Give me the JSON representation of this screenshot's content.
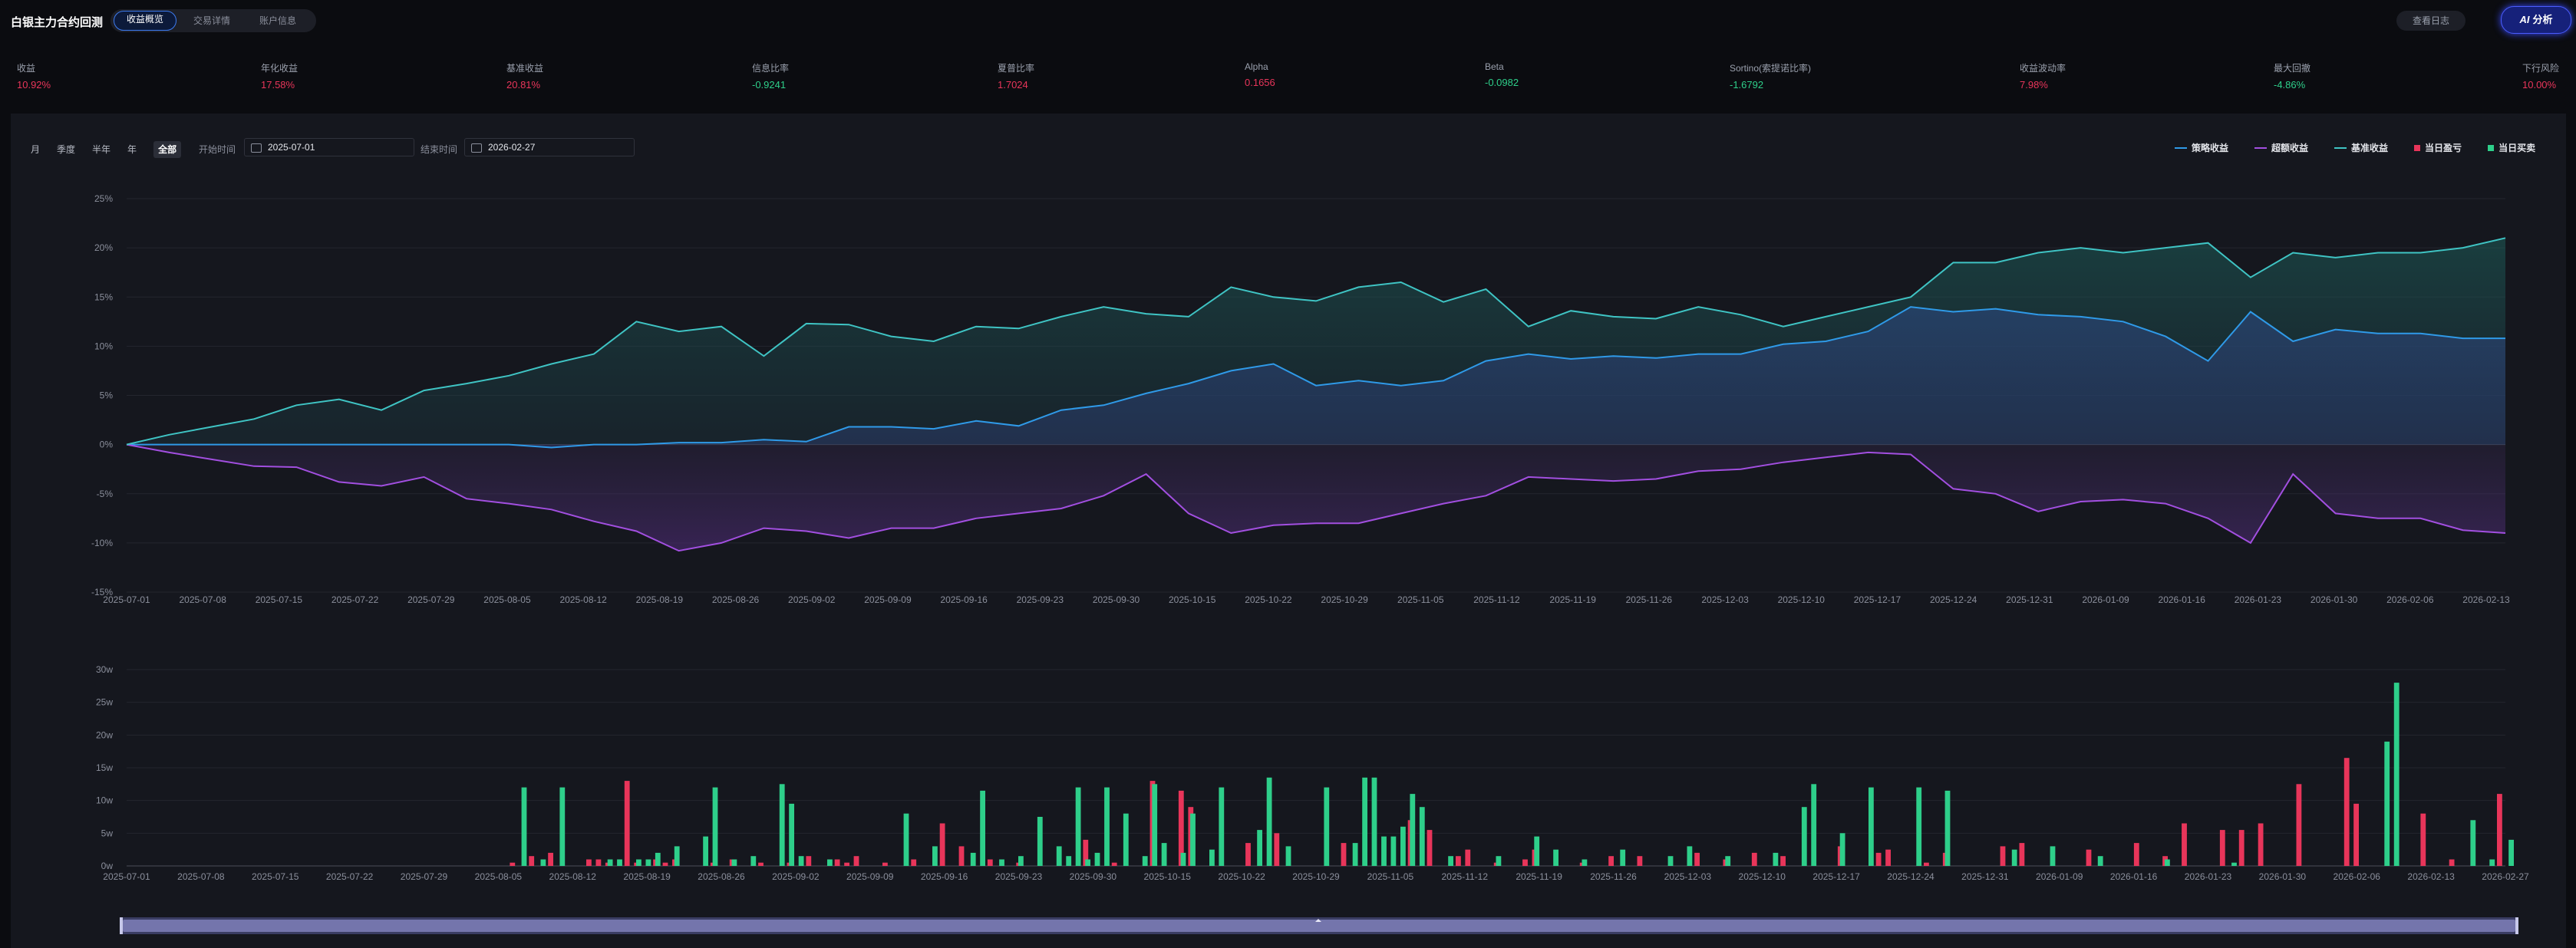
{
  "app": {
    "title": "白银主力合约回测"
  },
  "tabs": [
    {
      "label": "收益概览",
      "active": true
    },
    {
      "label": "交易详情",
      "active": false
    },
    {
      "label": "账户信息",
      "active": false
    }
  ],
  "header": {
    "log_button": "查看日志",
    "ai_button": "分析",
    "ai_icon": "AI"
  },
  "metrics": [
    {
      "label": "收益",
      "value": "10.92%",
      "color": "#e8355a"
    },
    {
      "label": "年化收益",
      "value": "17.58%",
      "color": "#e8355a"
    },
    {
      "label": "基准收益",
      "value": "20.81%",
      "color": "#e8355a"
    },
    {
      "label": "信息比率",
      "value": "-0.9241",
      "color": "#2ecf8a"
    },
    {
      "label": "夏普比率",
      "value": "1.7024",
      "color": "#e8355a"
    },
    {
      "label": "Alpha",
      "value": "0.1656",
      "color": "#e8355a"
    },
    {
      "label": "Beta",
      "value": "-0.0982",
      "color": "#2ecf8a"
    },
    {
      "label": "Sortino(索提诺比率)",
      "value": "-1.6792",
      "color": "#2ecf8a"
    },
    {
      "label": "收益波动率",
      "value": "7.98%",
      "color": "#e8355a"
    },
    {
      "label": "最大回撤",
      "value": "-4.86%",
      "color": "#2ecf8a"
    },
    {
      "label": "下行风险",
      "value": "10.00%",
      "color": "#e8355a"
    }
  ],
  "periods": [
    {
      "label": "月",
      "active": false
    },
    {
      "label": "季度",
      "active": false
    },
    {
      "label": "半年",
      "active": false
    },
    {
      "label": "年",
      "active": false
    },
    {
      "label": "全部",
      "active": true
    }
  ],
  "date_range": {
    "start_label": "开始时间",
    "start_value": "2025-07-01",
    "end_label": "结束时间",
    "end_value": "2026-02-27"
  },
  "legend": [
    {
      "label": "策略收益",
      "kind": "line",
      "color": "#2f9ae8"
    },
    {
      "label": "超额收益",
      "kind": "line",
      "color": "#a24fe0"
    },
    {
      "label": "基准收益",
      "kind": "line",
      "color": "#3fc4c4"
    },
    {
      "label": "当日盈亏",
      "kind": "bar",
      "color": "#e8355a"
    },
    {
      "label": "当日买卖",
      "kind": "bar",
      "color": "#2ecf8a"
    }
  ],
  "chart_data": [
    {
      "type": "line",
      "ylim": [
        -15,
        25
      ],
      "y_ticks": [
        "-15%",
        "-10%",
        "-5%",
        "0%",
        "5%",
        "10%",
        "15%",
        "20%",
        "25%"
      ],
      "x_ticks": [
        "2025-07-01",
        "2025-07-08",
        "2025-07-15",
        "2025-07-22",
        "2025-07-29",
        "2025-08-05",
        "2025-08-12",
        "2025-08-19",
        "2025-08-26",
        "2025-09-02",
        "2025-09-09",
        "2025-09-16",
        "2025-09-23",
        "2025-09-30",
        "2025-10-15",
        "2025-10-22",
        "2025-10-29",
        "2025-11-05",
        "2025-11-12",
        "2025-11-19",
        "2025-11-26",
        "2025-12-03",
        "2025-12-10",
        "2025-12-17",
        "2025-12-24",
        "2025-12-31",
        "2026-01-09",
        "2026-01-16",
        "2026-01-23",
        "2026-01-30",
        "2026-02-06",
        "2026-02-13"
      ],
      "series": [
        {
          "name": "策略收益",
          "color": "#2f9ae8",
          "values": [
            0,
            0,
            0,
            0,
            0,
            0,
            0,
            0,
            0,
            0,
            -0.3,
            0,
            0,
            0.2,
            0.2,
            0.5,
            0.3,
            1.8,
            1.8,
            1.6,
            2.4,
            1.9,
            3.5,
            4.0,
            5.2,
            6.2,
            7.5,
            8.2,
            6.0,
            6.5,
            6.0,
            6.5,
            8.5,
            9.2,
            8.7,
            9.0,
            8.8,
            9.2,
            9.2,
            10.2,
            10.5,
            11.5,
            14.0,
            13.5,
            13.8,
            13.2,
            13.0,
            12.5,
            11.0,
            8.5,
            13.5,
            10.5,
            11.7,
            11.3,
            11.3,
            10.8,
            10.8
          ]
        },
        {
          "name": "超额收益",
          "color": "#a24fe0",
          "values": [
            0,
            -0.8,
            -1.5,
            -2.2,
            -2.3,
            -3.8,
            -4.2,
            -3.3,
            -5.5,
            -6.0,
            -6.6,
            -7.8,
            -8.8,
            -10.8,
            -10.0,
            -8.5,
            -8.8,
            -9.5,
            -8.5,
            -8.5,
            -7.5,
            -7.0,
            -6.5,
            -5.2,
            -3.0,
            -7.0,
            -9.0,
            -8.2,
            -8.0,
            -8.0,
            -7.0,
            -6.0,
            -5.2,
            -3.3,
            -3.5,
            -3.7,
            -3.5,
            -2.7,
            -2.5,
            -1.8,
            -1.3,
            -0.8,
            -1.0,
            -4.5,
            -5.0,
            -6.8,
            -5.8,
            -5.6,
            -6.0,
            -7.5,
            -10.0,
            -3.0,
            -7.0,
            -7.5,
            -7.5,
            -8.7,
            -9.0
          ]
        },
        {
          "name": "基准收益",
          "color": "#3fc4c4",
          "values": [
            0,
            1.0,
            1.8,
            2.6,
            4.0,
            4.6,
            3.5,
            5.5,
            6.2,
            7.0,
            8.2,
            9.2,
            12.5,
            11.5,
            12.0,
            9.0,
            12.3,
            12.2,
            11.0,
            10.5,
            12.0,
            11.8,
            13.0,
            14.0,
            13.3,
            13.0,
            16.0,
            15.0,
            14.6,
            16.0,
            16.5,
            14.5,
            15.8,
            12.0,
            13.6,
            13.0,
            12.8,
            14.0,
            13.2,
            12.0,
            13.0,
            14.0,
            15.0,
            18.5,
            18.5,
            19.5,
            20.0,
            19.5,
            20.0,
            20.5,
            17.0,
            19.5,
            19.0,
            19.5,
            19.5,
            20.0,
            21.0
          ]
        }
      ]
    },
    {
      "type": "bar",
      "ylim": [
        0,
        30
      ],
      "y_ticks": [
        "0w",
        "5w",
        "10w",
        "15w",
        "20w",
        "25w",
        "30w"
      ],
      "x_ticks": [
        "2025-07-01",
        "2025-07-08",
        "2025-07-15",
        "2025-07-22",
        "2025-07-29",
        "2025-08-05",
        "2025-08-12",
        "2025-08-19",
        "2025-08-26",
        "2025-09-02",
        "2025-09-09",
        "2025-09-16",
        "2025-09-23",
        "2025-09-30",
        "2025-10-15",
        "2025-10-22",
        "2025-10-29",
        "2025-11-05",
        "2025-11-12",
        "2025-11-19",
        "2025-11-26",
        "2025-12-03",
        "2025-12-10",
        "2025-12-17",
        "2025-12-24",
        "2025-12-31",
        "2026-01-09",
        "2026-01-16",
        "2026-01-23",
        "2026-01-30",
        "2026-02-06",
        "2026-02-13",
        "2026-02-27"
      ],
      "series": [
        {
          "name": "当日盈亏",
          "color": "#e8355a",
          "values": [
            0,
            0,
            0,
            0,
            0,
            0,
            0,
            0,
            0,
            0,
            0,
            0,
            0,
            0,
            0,
            0,
            0,
            0,
            0,
            0,
            0,
            0,
            0,
            0,
            0,
            0,
            0,
            0,
            0,
            0,
            0,
            0,
            0,
            0,
            0,
            0,
            0,
            0,
            0,
            0,
            0.5,
            0,
            1.5,
            0,
            2,
            0,
            0,
            0,
            1,
            1,
            0.5,
            0,
            13,
            0.5,
            0,
            1,
            0.5,
            1,
            0,
            0,
            0,
            0.5,
            0,
            1,
            0,
            0,
            0.5,
            0,
            0,
            0.5,
            0,
            1.5,
            0,
            0,
            1,
            0.5,
            1.5,
            0,
            0,
            0.5,
            0,
            0,
            1,
            0,
            0,
            6.5,
            0,
            3,
            0,
            0,
            1,
            0,
            0,
            0.5,
            0,
            0,
            0,
            0,
            0,
            0,
            4,
            0,
            0,
            0.5,
            0,
            0,
            0,
            13,
            0,
            0,
            11.5,
            9,
            0,
            0,
            0,
            0,
            0,
            3.5,
            0,
            0,
            5,
            0,
            0,
            0,
            0,
            0,
            0,
            3.5,
            0,
            0,
            0,
            0,
            0,
            0,
            7,
            0,
            5.5,
            0,
            0,
            1.5,
            2.5,
            0,
            0,
            0.5,
            0,
            0,
            1,
            2.5,
            0,
            0,
            0,
            0,
            0.5,
            0,
            0,
            1.5,
            0,
            0,
            1.5,
            0,
            0,
            0,
            0,
            0,
            2,
            0,
            0,
            1,
            0,
            0,
            2,
            0,
            0,
            1.5,
            0,
            0,
            0,
            0,
            0,
            3,
            0,
            0,
            0,
            2,
            2.5,
            0,
            0,
            0,
            0.5,
            0,
            2,
            0,
            0,
            0,
            0,
            0,
            3,
            0,
            3.5,
            0,
            0,
            0,
            0,
            0,
            0,
            2.5,
            0,
            0,
            0,
            0,
            3.5,
            0,
            0,
            1.5,
            0,
            6.5,
            0,
            0,
            0,
            5.5,
            0,
            5.5,
            0,
            6.5,
            0,
            0,
            0,
            12.5,
            0,
            0,
            0,
            0,
            16.5,
            9.5,
            0,
            0,
            0,
            0,
            0,
            0,
            8,
            0,
            0,
            1,
            0,
            0,
            0,
            0,
            11
          ]
        },
        {
          "name": "当日买卖",
          "color": "#2ecf8a",
          "values": [
            0,
            0,
            0,
            0,
            0,
            0,
            0,
            0,
            0,
            0,
            0,
            0,
            0,
            0,
            0,
            0,
            0,
            0,
            0,
            0,
            0,
            0,
            0,
            0,
            0,
            0,
            0,
            0,
            0,
            0,
            0,
            0,
            0,
            0,
            0,
            0,
            0,
            0,
            0,
            0,
            0,
            12,
            0,
            1,
            0,
            12,
            0,
            0,
            0,
            0,
            1,
            1,
            0,
            1,
            1,
            2,
            0,
            3,
            0,
            0,
            4.5,
            12,
            0,
            1,
            0,
            1.5,
            0,
            0,
            12.5,
            9.5,
            1.5,
            0,
            0,
            1,
            0,
            0,
            0,
            0,
            0,
            0,
            0,
            8,
            0,
            0,
            3,
            0,
            0,
            0,
            2,
            11.5,
            0,
            1,
            0,
            1.5,
            0,
            7.5,
            0,
            3,
            1.5,
            12,
            1,
            2,
            12,
            0,
            8,
            0,
            1.5,
            12.5,
            3.5,
            0,
            2,
            8,
            0,
            2.5,
            12,
            0,
            0,
            0,
            5.5,
            13.5,
            0,
            3,
            0,
            0,
            0,
            12,
            0,
            0,
            3.5,
            13.5,
            13.5,
            4.5,
            4.5,
            6,
            11,
            9,
            0,
            0,
            1.5,
            0,
            0,
            0,
            0,
            1.5,
            0,
            0,
            0,
            4.5,
            0,
            2.5,
            0,
            0,
            1,
            0,
            0,
            0,
            2.5,
            0,
            0,
            0,
            0,
            1.5,
            0,
            3,
            0,
            0,
            0,
            1.5,
            0,
            0,
            0,
            0,
            2,
            0,
            0,
            9,
            12.5,
            0,
            0,
            5,
            0,
            0,
            12,
            0,
            0,
            0,
            0,
            12,
            0,
            0,
            11.5,
            0,
            0,
            0,
            0,
            0,
            0,
            2.5,
            0,
            0,
            0,
            3,
            0,
            0,
            0,
            0,
            1.5,
            0,
            0,
            0,
            0,
            0,
            0,
            1,
            0,
            0,
            0,
            0,
            0,
            0,
            0.5,
            0,
            0,
            0,
            0,
            0,
            0,
            0,
            0,
            0,
            0,
            0,
            0,
            0,
            0,
            0,
            19,
            28,
            0,
            0,
            0,
            0,
            0,
            0,
            0,
            7,
            0,
            1,
            0,
            4,
            0,
            0,
            0,
            0,
            0
          ]
        }
      ]
    }
  ]
}
